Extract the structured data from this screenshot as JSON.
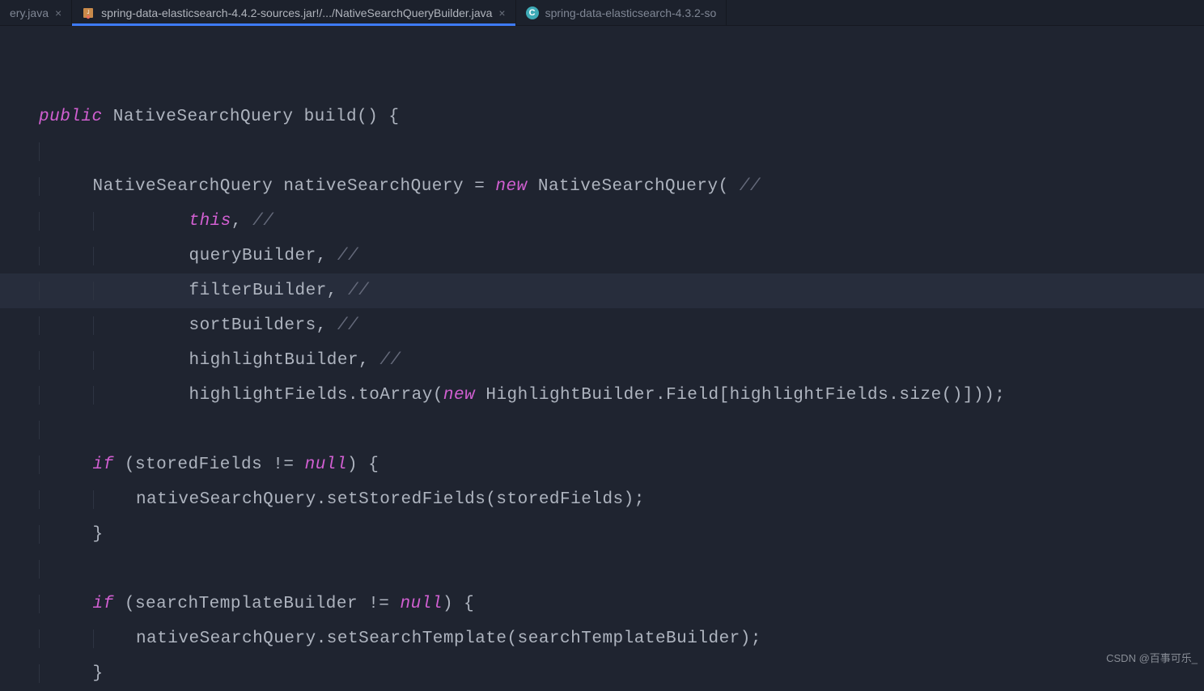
{
  "tabs": [
    {
      "label": "ery.java",
      "icon": "none",
      "active": false
    },
    {
      "label": "spring-data-elasticsearch-4.4.2-sources.jar!/.../NativeSearchQueryBuilder.java",
      "icon": "java",
      "active": true
    },
    {
      "label": "spring-data-elasticsearch-4.3.2-so",
      "icon": "c",
      "active": false,
      "noclose": true
    }
  ],
  "code": {
    "l1_public": "public",
    "l1_type": " NativeSearchQuery ",
    "l1_method": "build",
    "l1_rest": "() {",
    "l3_a": "NativeSearchQuery nativeSearchQuery = ",
    "l3_new": "new",
    "l3_b": " NativeSearchQuery( ",
    "l3_c": "//",
    "l4_this": "this",
    "l4_rest": ", ",
    "l4_c": "//",
    "l5_a": "queryBuilder, ",
    "l5_c": "//",
    "l6_a": "filterBuilder, ",
    "l6_c": "//",
    "l7_a": "sortBuilders, ",
    "l7_c": "//",
    "l8_a": "highlightBuilder, ",
    "l8_c": "//",
    "l9_a": "highlightFields.toArray(",
    "l9_new": "new",
    "l9_b": " HighlightBuilder.Field[highlightFields.size()]));",
    "l11_if": "if",
    "l11_a": " (storedFields != ",
    "l11_null": "null",
    "l11_b": ") {",
    "l12_a": "nativeSearchQuery.setStoredFields(storedFields);",
    "l13_a": "}",
    "l15_if": "if",
    "l15_a": " (searchTemplateBuilder != ",
    "l15_null": "null",
    "l15_b": ") {",
    "l16_a": "nativeSearchQuery.setSearchTemplate(searchTemplateBuilder);",
    "l17_a": "}"
  },
  "watermark": "CSDN @百事可乐_"
}
